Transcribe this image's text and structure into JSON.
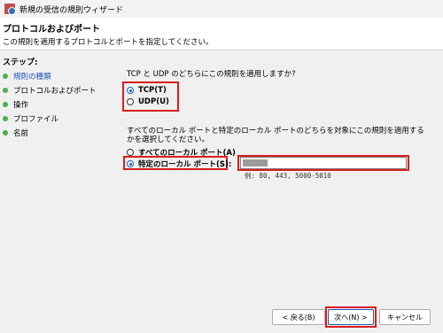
{
  "window": {
    "title": "新規の受信の規則ウィザード"
  },
  "header": {
    "title": "プロトコルおよびポート",
    "subtitle": "この規則を適用するプロトコルとポートを指定してください。"
  },
  "sidebar": {
    "title": "ステップ:",
    "items": [
      {
        "label": "規則の種類",
        "state": "completed"
      },
      {
        "label": "プロトコルおよびポート",
        "state": "current"
      },
      {
        "label": "操作",
        "state": "pending"
      },
      {
        "label": "プロファイル",
        "state": "pending"
      },
      {
        "label": "名前",
        "state": "pending"
      }
    ]
  },
  "protocol": {
    "question": "TCP と UDP のどちらにこの規則を適用しますか?",
    "options": [
      {
        "label": "TCP(T)",
        "selected": true
      },
      {
        "label": "UDP(U)",
        "selected": false
      }
    ]
  },
  "ports": {
    "question": "すべてのローカル ポートと特定のローカル ポートのどちらを対象にこの規則を適用するかを選択してください。",
    "options": [
      {
        "label": "すべてのローカル ポート(A)",
        "selected": false
      },
      {
        "label": "特定のローカル ポート(S):",
        "selected": true
      }
    ],
    "example": "例: 80, 443, 5000-5010"
  },
  "buttons": {
    "back": "< 戻る(B)",
    "next": "次へ(N) >",
    "cancel": "キャンセル"
  },
  "colors": {
    "highlight": "#d81e1e",
    "link": "#1a52b8",
    "step_dot": "#4caf50"
  }
}
